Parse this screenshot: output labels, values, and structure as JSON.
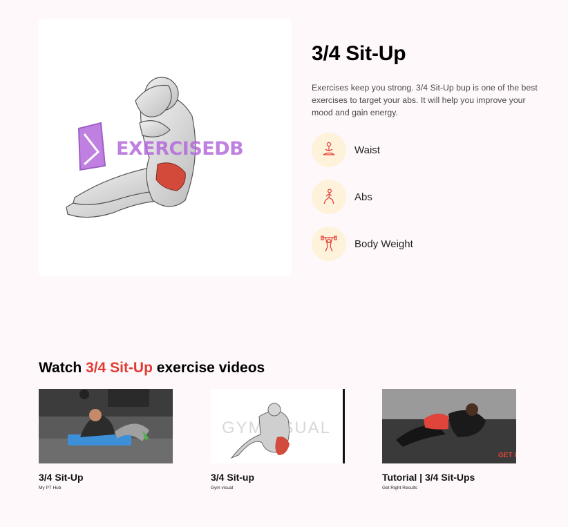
{
  "exercise": {
    "name": "3/4 Sit-Up",
    "description": "Exercises keep you strong. 3/4 Sit-Up bup is one of the best exercises to target your abs. It will help you improve your mood and gain energy.",
    "watermark": "EXERCISEDB",
    "details": [
      {
        "label": "Waist",
        "icon": "meditation-icon"
      },
      {
        "label": "Abs",
        "icon": "lunge-figure-icon"
      },
      {
        "label": "Body Weight",
        "icon": "weightlifter-icon"
      }
    ]
  },
  "videos_section": {
    "prefix": "Watch",
    "highlight": "3/4 Sit-Up",
    "suffix": "exercise videos"
  },
  "videos": [
    {
      "title": "3/4 Sit-Up",
      "channel": "My PT Hub"
    },
    {
      "title": "3/4 Sit-up",
      "channel": "Gym visual",
      "watermark": "GYMVISUAL"
    },
    {
      "title": "Tutorial | 3/4 Sit-Ups",
      "channel": "Get Right Results",
      "watermark": "GET R"
    }
  ],
  "colors": {
    "page_bg": "#fff8fa",
    "accent_red": "#e13b34",
    "chip_bg": "#fff2db",
    "watermark_purple": "#b46bdc"
  }
}
